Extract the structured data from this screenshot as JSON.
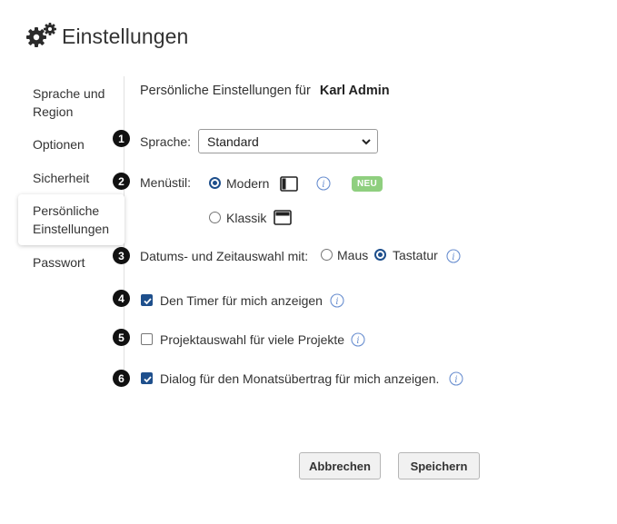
{
  "header": {
    "title": "Einstellungen",
    "icon": "gears-icon"
  },
  "sidebar": {
    "items": [
      {
        "label": "Sprache und Region"
      },
      {
        "label": "Optionen"
      },
      {
        "label": "Sicherheit"
      },
      {
        "label": "Persönliche Einstellungen",
        "active": true
      },
      {
        "label": "Passwort"
      }
    ]
  },
  "main": {
    "title_prefix": "Persönliche Einstellungen für",
    "user_name": "Karl Admin",
    "rows": [
      {
        "number": "1",
        "label": "Sprache:",
        "select_value": "Standard"
      },
      {
        "number": "2",
        "label": "Menüstil:",
        "options": [
          {
            "label": "Modern",
            "selected": true,
            "badge": "NEU"
          },
          {
            "label": "Klassik",
            "selected": false
          }
        ]
      },
      {
        "number": "3",
        "label": "Datums- und Zeitauswahl mit:",
        "options": [
          {
            "label": "Maus",
            "selected": false
          },
          {
            "label": "Tastatur",
            "selected": true
          }
        ]
      },
      {
        "number": "4",
        "label": "Den Timer für mich anzeigen",
        "checked": true
      },
      {
        "number": "5",
        "label": "Projektauswahl für viele Projekte",
        "checked": false
      },
      {
        "number": "6",
        "label": "Dialog für den Monatsübertrag für mich anzeigen.",
        "checked": true
      }
    ]
  },
  "buttons": {
    "cancel": "Abbrechen",
    "save": "Speichern"
  },
  "colors": {
    "accent": "#1e4f8c",
    "badge": "#8fcf7f",
    "info": "#6a8fd0"
  }
}
